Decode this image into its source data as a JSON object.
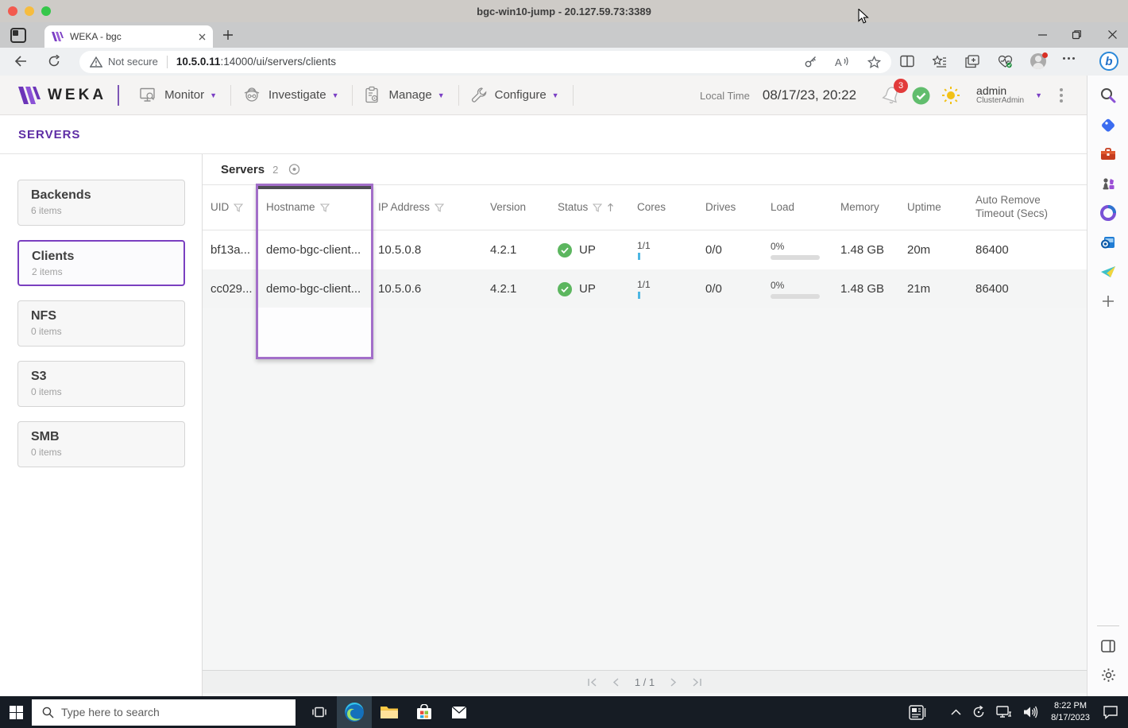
{
  "remote_window": {
    "title": "bgc-win10-jump - 20.127.59.73:3389"
  },
  "browser": {
    "tab_title": "WEKA - bgc",
    "security_label": "Not secure",
    "url_host": "10.5.0.11",
    "url_rest": ":14000/ui/servers/clients"
  },
  "app": {
    "brand": "WEKA",
    "nav": [
      {
        "label": "Monitor"
      },
      {
        "label": "Investigate"
      },
      {
        "label": "Manage"
      },
      {
        "label": "Configure"
      }
    ],
    "local_time_label": "Local Time",
    "local_time_value": "08/17/23, 20:22",
    "notification_count": "3",
    "user": {
      "name": "admin",
      "role": "ClusterAdmin"
    },
    "page_title": "SERVERS",
    "sidebar": [
      {
        "label": "Backends",
        "count": "6 items"
      },
      {
        "label": "Clients",
        "count": "2 items"
      },
      {
        "label": "NFS",
        "count": "0 items"
      },
      {
        "label": "S3",
        "count": "0 items"
      },
      {
        "label": "SMB",
        "count": "0 items"
      }
    ],
    "table": {
      "title": "Servers",
      "count": "2",
      "columns": [
        "UID",
        "Hostname",
        "IP Address",
        "Version",
        "Status",
        "Cores",
        "Drives",
        "Load",
        "Memory",
        "Uptime",
        "Auto Remove Timeout (Secs)"
      ],
      "rows": [
        {
          "uid": "bf13a...",
          "hostname": "demo-bgc-client...",
          "ip": "10.5.0.8",
          "version": "4.2.1",
          "status": "UP",
          "cores": "1/1",
          "drives": "0/0",
          "load": "0%",
          "memory": "1.48 GB",
          "uptime": "20m",
          "timeout": "86400"
        },
        {
          "uid": "cc029...",
          "hostname": "demo-bgc-client...",
          "ip": "10.5.0.6",
          "version": "4.2.1",
          "status": "UP",
          "cores": "1/1",
          "drives": "0/0",
          "load": "0%",
          "memory": "1.48 GB",
          "uptime": "21m",
          "timeout": "86400"
        }
      ],
      "pagination": "1 / 1"
    }
  },
  "taskbar": {
    "search_placeholder": "Type here to search",
    "clock_time": "8:22 PM",
    "clock_date": "8/17/2023"
  }
}
